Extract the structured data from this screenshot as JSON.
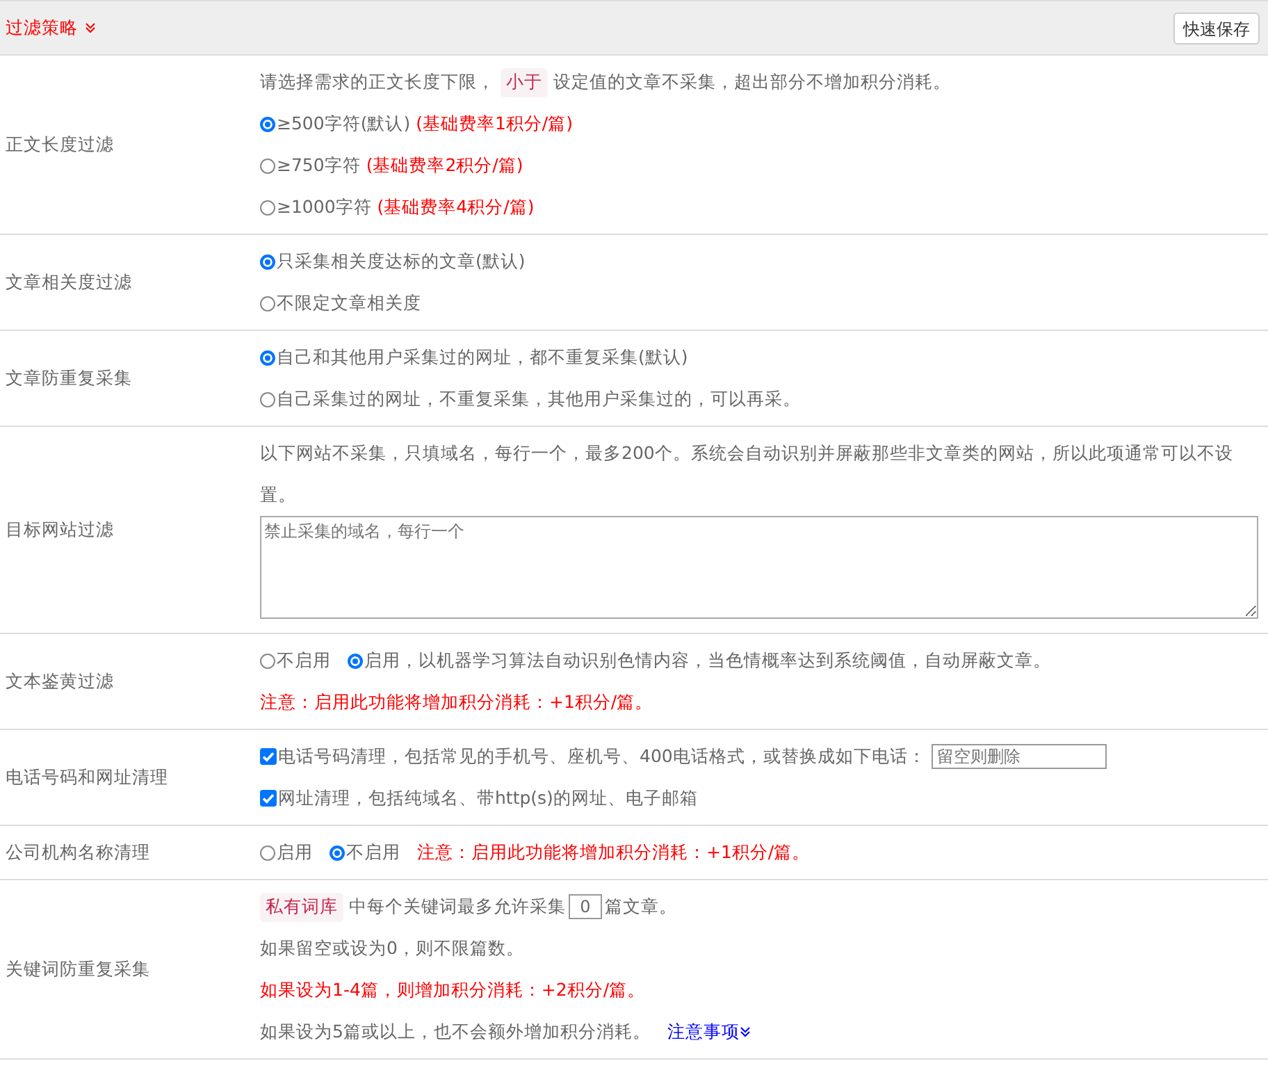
{
  "header": {
    "title": "过滤策略",
    "save_button": "快速保存"
  },
  "rows": [
    {
      "label": "正文长度过滤",
      "items": [
        {
          "kind": "tagged_text",
          "before": "请选择需求的正文长度下限，",
          "tag": "小于",
          "after": "设定值的文章不采集，超出部分不增加积分消耗。"
        },
        {
          "kind": "radio",
          "label": "≥500字符(默认)",
          "note": "(基础费率1积分/篇)",
          "selected": true
        },
        {
          "kind": "radio",
          "label": "≥750字符",
          "note": "(基础费率2积分/篇)",
          "selected": false
        },
        {
          "kind": "radio",
          "label": "≥1000字符",
          "note": "(基础费率4积分/篇)",
          "selected": false
        }
      ]
    },
    {
      "label": "文章相关度过滤",
      "items": [
        {
          "kind": "radio",
          "label": "只采集相关度达标的文章(默认)",
          "selected": true
        },
        {
          "kind": "radio",
          "label": "不限定文章相关度",
          "selected": false
        }
      ]
    },
    {
      "label": "文章防重复采集",
      "items": [
        {
          "kind": "radio",
          "label": "自己和其他用户采集过的网址，都不重复采集(默认)",
          "selected": true
        },
        {
          "kind": "radio",
          "label": "自己采集过的网址，不重复采集，其他用户采集过的，可以再采。",
          "selected": false
        }
      ]
    },
    {
      "label": "目标网站过滤",
      "items": [
        {
          "kind": "hint",
          "text": "以下网站不采集，只填域名，每行一个，最多200个。系统会自动识别并屏蔽那些非文章类的网站，所以此项通常可以不设置。"
        },
        {
          "kind": "textarea",
          "placeholder": "禁止采集的域名，每行一个"
        }
      ]
    },
    {
      "label": "文本鉴黄过滤",
      "items": [
        {
          "kind": "radio_inline",
          "options": [
            {
              "label": "不启用",
              "selected": false
            },
            {
              "label": "启用，以机器学习算法自动识别色情内容，当色情概率达到系统阈值，自动屏蔽文章。",
              "selected": true
            }
          ]
        },
        {
          "kind": "warning",
          "text": "注意：启用此功能将增加积分消耗：+1积分/篇。"
        }
      ]
    },
    {
      "label": "电话号码和网址清理",
      "items": [
        {
          "kind": "checkbox",
          "label": "电话号码清理，包括常见的手机号、座机号、400电话格式，或替换成如下电话：",
          "checked": true,
          "field": {
            "placeholder": "留空则删除"
          }
        },
        {
          "kind": "checkbox",
          "label": "网址清理，包括纯域名、带http(s)的网址、电子邮箱",
          "checked": true
        }
      ]
    },
    {
      "label": "公司机构名称清理",
      "items": [
        {
          "kind": "radio_inline",
          "options": [
            {
              "label": "启用",
              "selected": false
            },
            {
              "label": "不启用",
              "selected": true
            }
          ],
          "warning": "注意：启用此功能将增加积分消耗：+1积分/篇。"
        }
      ]
    },
    {
      "label": "关键词防重复采集",
      "items": [
        {
          "kind": "tag_input",
          "tag": "私有词库",
          "before": "中每个关键词最多允许采集",
          "value": "0",
          "after": "篇文章。"
        },
        {
          "kind": "hint",
          "text": "如果留空或设为0，则不限篇数。"
        },
        {
          "kind": "warning",
          "text": "如果设为1-4篇，则增加积分消耗：+2积分/篇。"
        },
        {
          "kind": "hint",
          "text": "如果设为5篇或以上，也不会额外增加积分消耗。",
          "link": "注意事项"
        }
      ]
    }
  ]
}
